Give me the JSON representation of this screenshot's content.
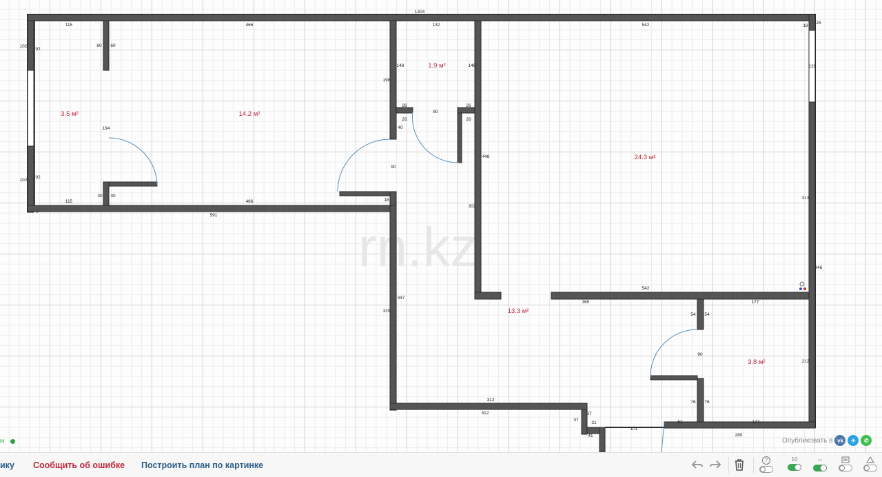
{
  "watermark": "rn.kz",
  "rooms": [
    {
      "area": "3.5 м²"
    },
    {
      "area": "14.2 м²"
    },
    {
      "area": "1.9 м²"
    },
    {
      "area": "24.3 м²"
    },
    {
      "area": "13.3 м²"
    },
    {
      "area": "3.8 м²"
    }
  ],
  "dimensions": [
    "1304",
    "115",
    "466",
    "132",
    "542",
    "18",
    "25",
    "102",
    "92",
    "60",
    "60",
    "148",
    "148",
    "198",
    "120",
    "26",
    "80",
    "26",
    "26",
    "40",
    "26",
    "194",
    "448",
    "24.3",
    "90",
    "102",
    "92",
    "30",
    "30",
    "115",
    "466",
    "18",
    "0",
    "591",
    "302",
    "313",
    "946",
    "542",
    "365",
    "177",
    "347",
    "329",
    "54",
    "54",
    "90",
    "212",
    "76",
    "76",
    "312",
    "312",
    "37",
    "37",
    "31",
    "53",
    "177",
    "41",
    "101",
    "280"
  ],
  "status": {
    "letter": "н"
  },
  "publish": {
    "label": "Опубликовать в",
    "networks": [
      "vk-icon",
      "telegram-icon",
      "whatsapp-icon"
    ]
  },
  "bottom": {
    "link_left": "ику",
    "link_report": "Сообщить об ошибке",
    "link_build": "Построить план по картинке",
    "colors": {
      "report": "#c0273a",
      "build": "#2d5e86"
    }
  },
  "toolbar": {
    "help": "?",
    "grid_label": "10",
    "resize": "↔",
    "toggles": {
      "help": false,
      "grid": true,
      "resize": true,
      "doc": false,
      "view": false
    }
  }
}
